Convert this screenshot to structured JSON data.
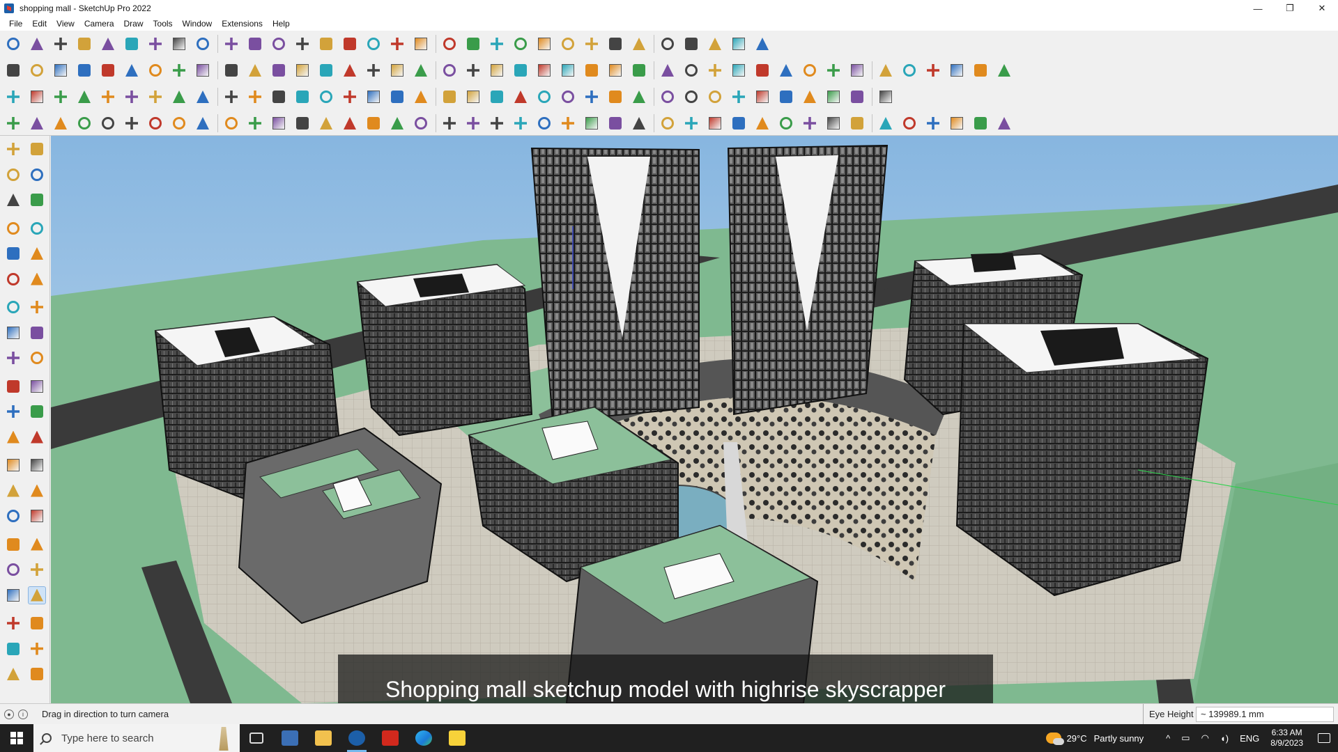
{
  "window": {
    "title": "shopping mall - SketchUp Pro 2022",
    "controls": [
      "—",
      "❐",
      "✕"
    ]
  },
  "menu": [
    "File",
    "Edit",
    "View",
    "Camera",
    "Draw",
    "Tools",
    "Window",
    "Extensions",
    "Help"
  ],
  "toolbar_icons": {
    "row1": [
      "zoom-icon",
      "select-icon",
      "eraser-icon",
      "pencil-icon",
      "arc-icon",
      "shape-icon",
      "push-pull-icon",
      "follow-me-icon",
      "move-icon",
      "rotate-icon",
      "scale-icon",
      "tape-measure-icon",
      "text-icon",
      "paint-bucket-icon",
      "orbit-icon",
      "pan-icon",
      "zoom-window-icon",
      "zoom-extents-icon",
      "warehouse-icon",
      "extension-warehouse-icon",
      "layout-icon",
      "extension-manager-icon",
      "profile-icon",
      "components-icon",
      "materials-icon",
      "section-icon",
      "sandbox-icon",
      "solid-icon",
      "flip-icon",
      "undo-icon",
      "redo-icon",
      "style-icon"
    ],
    "row2": [
      "iso-view-icon",
      "top-view-icon",
      "front-view-icon",
      "push-pull-icon",
      "extrude-icon",
      "extrude-icon",
      "extrude-icon",
      "extrude-icon",
      "extrude-icon",
      "extrude-icon",
      "extrude-icon",
      "round-corner-icon",
      "plane-icon",
      "plane-icon",
      "plane-icon",
      "green-box-icon",
      "green-box-icon",
      "house-icon",
      "house-icon",
      "house-icon",
      "house-icon",
      "house-icon",
      "fredo-icon",
      "tag-icon",
      "tools-icon",
      "ring-icon",
      "ring-icon",
      "ring-icon",
      "ring-icon",
      "ring-icon",
      "ring-icon",
      "ring-icon",
      "ring-icon",
      "ring-icon",
      "ring-icon",
      "ring-icon",
      "shape-icon",
      "shape-icon",
      "shape-icon",
      "shape-icon",
      "shape-icon",
      "shape-icon"
    ],
    "row3": [
      "blue-plane-icon",
      "blue-plane-icon",
      "yellow-plane-icon",
      "green-plane-icon",
      "red-plane-icon",
      "grey-plane-icon",
      "arc-icon",
      "red-box-icon",
      "grid-icon",
      "curtain-icon",
      "box-icon",
      "curve-icon",
      "bezier-icon",
      "cross-icon",
      "cross-icon",
      "cross-icon",
      "cone-icon",
      "cone-icon",
      "pyramid-icon",
      "spiral-icon",
      "spiral-icon",
      "spiral-icon",
      "star-icon",
      "cylinder-icon",
      "hook-icon",
      "sort-icon",
      "sort-icon",
      "sort-icon",
      "cube-icon",
      "grid-icon",
      "grid-icon",
      "grid-icon",
      "grid-icon",
      "grid-icon",
      "dots-icon",
      "dots-icon",
      "grid-icon"
    ],
    "row4": [
      "bezier-icon",
      "spline-icon",
      "car-icon",
      "cut-icon",
      "gear-icon",
      "box-icon",
      "twist-icon",
      "sphere-icon",
      "bulb-icon",
      "bend-icon",
      "line-icon",
      "line-icon",
      "line-icon",
      "line-icon",
      "frame-icon",
      "stairs-icon",
      "stairs-icon",
      "stairs-icon",
      "stairs-icon",
      "hand-icon",
      "leaf-icon",
      "arrow-icon",
      "stairs-icon",
      "stairs-icon",
      "stairs-icon",
      "stairs-icon",
      "stairs-icon",
      "stairs-icon",
      "stairs-icon",
      "stairs-icon",
      "stairs-icon",
      "stairs-icon",
      "stairs-icon",
      "stairs-icon",
      "stairs-icon",
      "stairs-icon",
      "stairs-icon",
      "stairs-icon",
      "stairs-icon",
      "stairs-icon",
      "stairs-icon",
      "stairs-icon"
    ]
  },
  "left_toolbar": [
    "select-icon",
    "orbit-icon",
    "paint-bucket-icon",
    "eraser-icon",
    "component-icon",
    "pencil-icon",
    "line-icon",
    "freehand-icon",
    "rectangle-icon",
    "rotated-rectangle-icon",
    "circle-icon",
    "polygon-icon",
    "arc-icon",
    "arc-2-icon",
    "pie-icon",
    "arc-3-icon",
    "move-icon",
    "push-pull-icon",
    "rotate-icon",
    "follow-me-icon",
    "scale-icon",
    "offset-icon",
    "tape-measure-icon",
    "dimension-icon",
    "protractor-icon",
    "text-icon",
    "axes-icon",
    "3d-text-icon",
    "orbit-icon",
    "pan-icon",
    "zoom-icon",
    "zoom-window-icon",
    "zoom-extents-icon",
    "previous-view-icon",
    "position-camera-icon",
    "look-around-icon",
    "walk-icon",
    "section-plane-icon",
    "warehouse-icon",
    "extension-warehouse-icon",
    "layout-icon",
    "extension-manager-icon"
  ],
  "viewport": {
    "caption": "Shopping mall sketchup model with highrise skyscrapper",
    "sky_color": "#9fc5e4",
    "ground_color": "#7fb990",
    "road_color": "#3a3a3a"
  },
  "statusbar": {
    "hint": "Drag in direction to turn camera",
    "vcb_label": "Eye Height",
    "vcb_value": "~ 139989.1 mm"
  },
  "taskbar": {
    "search_placeholder": "Type here to search",
    "weather_temp": "29°C",
    "weather_text": "Partly sunny",
    "chevron": "^",
    "language": "ENG",
    "time": "6:33 AM",
    "date": "8/9/2023",
    "apps": [
      "task-view-icon",
      "calculator-icon",
      "file-explorer-icon",
      "sketchup-icon",
      "acrobat-icon",
      "edge-icon",
      "sticky-notes-icon"
    ]
  }
}
